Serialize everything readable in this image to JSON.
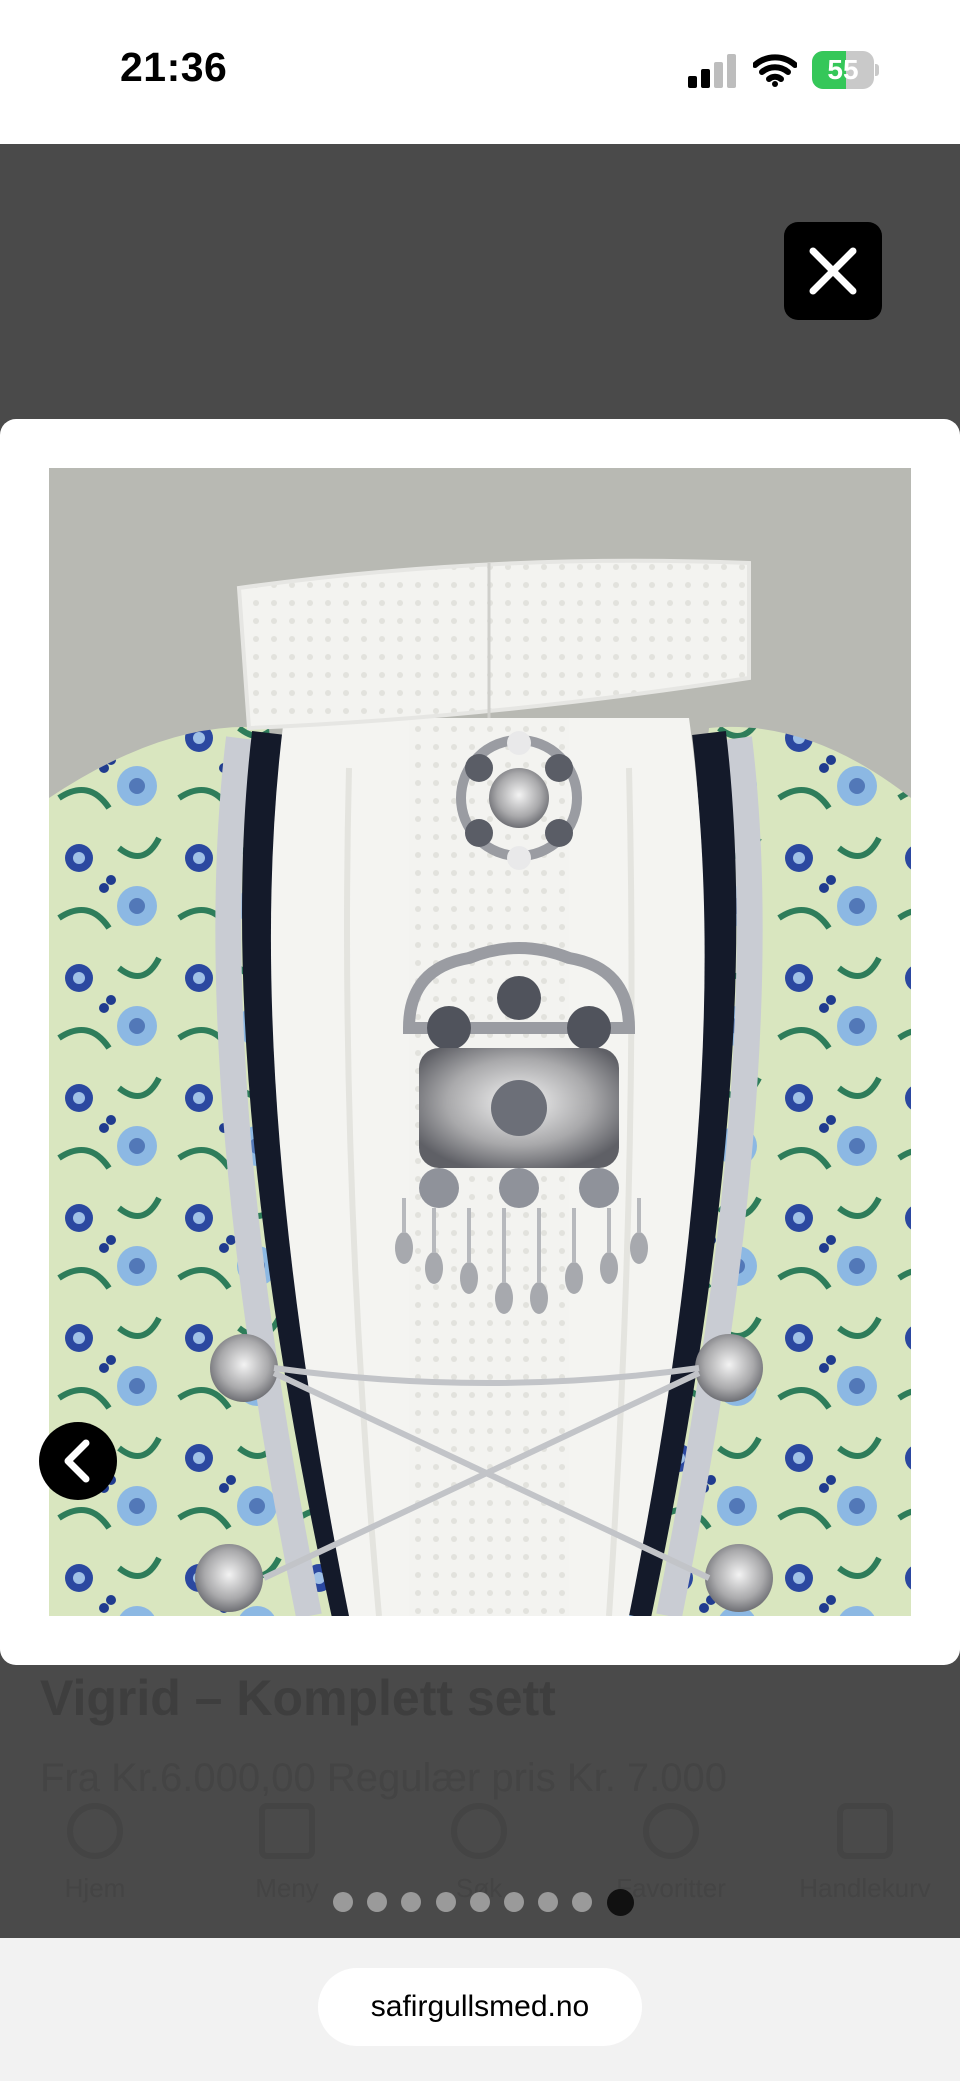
{
  "status_bar": {
    "time": "21:36",
    "battery_level": "55",
    "battery_fraction": 0.55,
    "icons": [
      "cellular-signal-icon",
      "wifi-icon",
      "battery-charging-icon"
    ]
  },
  "background_page": {
    "title": "Vigrid – Komplett sett",
    "subtitle": "Fra  Kr.6.000,00  Regulær pris Kr. 7.000",
    "nav_items": [
      {
        "label": "Hjem",
        "icon": "home-icon"
      },
      {
        "label": "Meny",
        "icon": "menu-icon"
      },
      {
        "label": "Søk",
        "icon": "search-icon"
      },
      {
        "label": "Favoritter",
        "icon": "heart-icon"
      },
      {
        "label": "Handlekurv",
        "icon": "bag-icon"
      }
    ]
  },
  "viewer": {
    "close_icon": "close-icon",
    "prev_icon": "chevron-left-icon",
    "image_description_icon": "product-photo",
    "pager": {
      "count": 9,
      "active_index": 8
    }
  },
  "browser": {
    "url": "safirgullsmed.no"
  },
  "colors": {
    "overlay": "#505050",
    "battery_green": "#35c759",
    "card": "#ffffff"
  }
}
